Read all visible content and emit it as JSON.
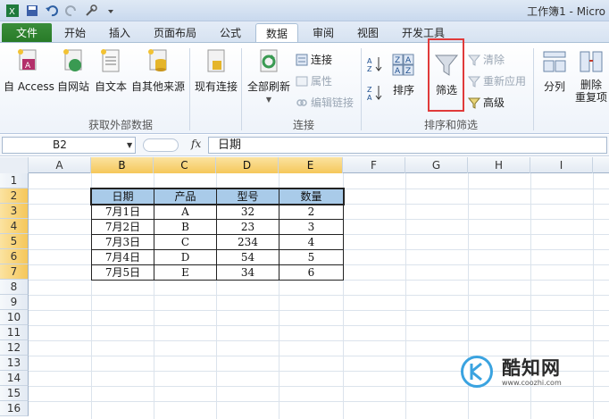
{
  "window": {
    "title": "工作簿1 - Micro"
  },
  "quick_access": {
    "icons": [
      "save-icon",
      "undo-icon",
      "redo-icon",
      "tools-icon"
    ]
  },
  "tabs": [
    {
      "label": "文件"
    },
    {
      "label": "开始"
    },
    {
      "label": "插入"
    },
    {
      "label": "页面布局"
    },
    {
      "label": "公式"
    },
    {
      "label": "数据"
    },
    {
      "label": "审阅"
    },
    {
      "label": "视图"
    },
    {
      "label": "开发工具"
    }
  ],
  "ribbon": {
    "get_external": {
      "label": "获取外部数据",
      "buttons": [
        "自 Access",
        "自网站",
        "自文本",
        "自其他来源",
        "现有连接"
      ]
    },
    "connections": {
      "label": "连接",
      "refresh_all": "全部刷新",
      "connections": "连接",
      "properties": "属性",
      "edit_links": "编辑链接"
    },
    "sort_filter": {
      "label": "排序和筛选",
      "sort": "排序",
      "filter": "筛选",
      "clear": "清除",
      "reapply": "重新应用",
      "advanced": "高级"
    },
    "data_tools": {
      "text_to_columns": "分列",
      "remove_duplicates_1": "删除",
      "remove_duplicates_2": "重复项"
    }
  },
  "formula_bar": {
    "name_box": "B2",
    "fx": "fx",
    "value": "日期"
  },
  "columns": [
    "A",
    "B",
    "C",
    "D",
    "E",
    "F",
    "G",
    "H",
    "I"
  ],
  "rows": [
    "1",
    "2",
    "3",
    "4",
    "5",
    "6",
    "7",
    "8",
    "9",
    "10",
    "11",
    "12",
    "13",
    "14",
    "15",
    "16"
  ],
  "table": {
    "headers": [
      "日期",
      "产品",
      "型号",
      "数量"
    ],
    "rows": [
      [
        "7月1日",
        "A",
        "32",
        "2"
      ],
      [
        "7月2日",
        "B",
        "23",
        "3"
      ],
      [
        "7月3日",
        "C",
        "234",
        "4"
      ],
      [
        "7月4日",
        "D",
        "54",
        "5"
      ],
      [
        "7月5日",
        "E",
        "34",
        "6"
      ]
    ]
  },
  "watermark": {
    "text": "酷知网",
    "url": "www.coozhi.com"
  },
  "colors": {
    "header_fill": "#a9cbe9",
    "selection": "#f5c75a",
    "highlight_box": "#e03a3a"
  }
}
